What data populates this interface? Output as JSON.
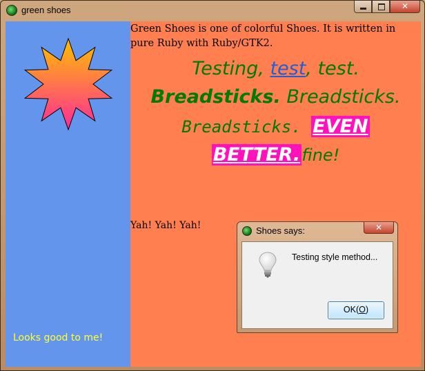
{
  "window": {
    "title": "green shoes",
    "minimize": "–",
    "maximize": "□",
    "close": "✕"
  },
  "sidebar": {
    "note": "Looks good to me!",
    "star_colors": [
      "#ffc000",
      "#ff2a99"
    ]
  },
  "main": {
    "intro": "Green Shoes is one of colorful Shoes. It is written in pure Ruby with Ruby/GTK2.",
    "line1_a": "Testing, ",
    "line1_link": "test",
    "line1_b": ", test.",
    "line2_bold": "Breadsticks.",
    "line2_rest": " Breadsticks.",
    "line3_mono": "Breadsticks.",
    "highlight": "EVEN BETTER.",
    "highlight_1": "EVEN",
    "highlight_2": "BETTER.",
    "tail": "fine!",
    "yah": "Yah! Yah! Yah!"
  },
  "dialog": {
    "title": "Shoes says:",
    "close": "✕",
    "message": "Testing style method...",
    "ok_label": "OK(O)",
    "ok_prefix": "OK(",
    "ok_mnemonic": "O",
    "ok_suffix": ")"
  },
  "colors": {
    "sidebar_bg": "#6495ed",
    "main_bg": "#ff7f50",
    "text_green": "#007a00",
    "link_blue": "#1f5fd8",
    "highlight_bg": "#ff11bb",
    "note_yellow": "#ffff33"
  }
}
